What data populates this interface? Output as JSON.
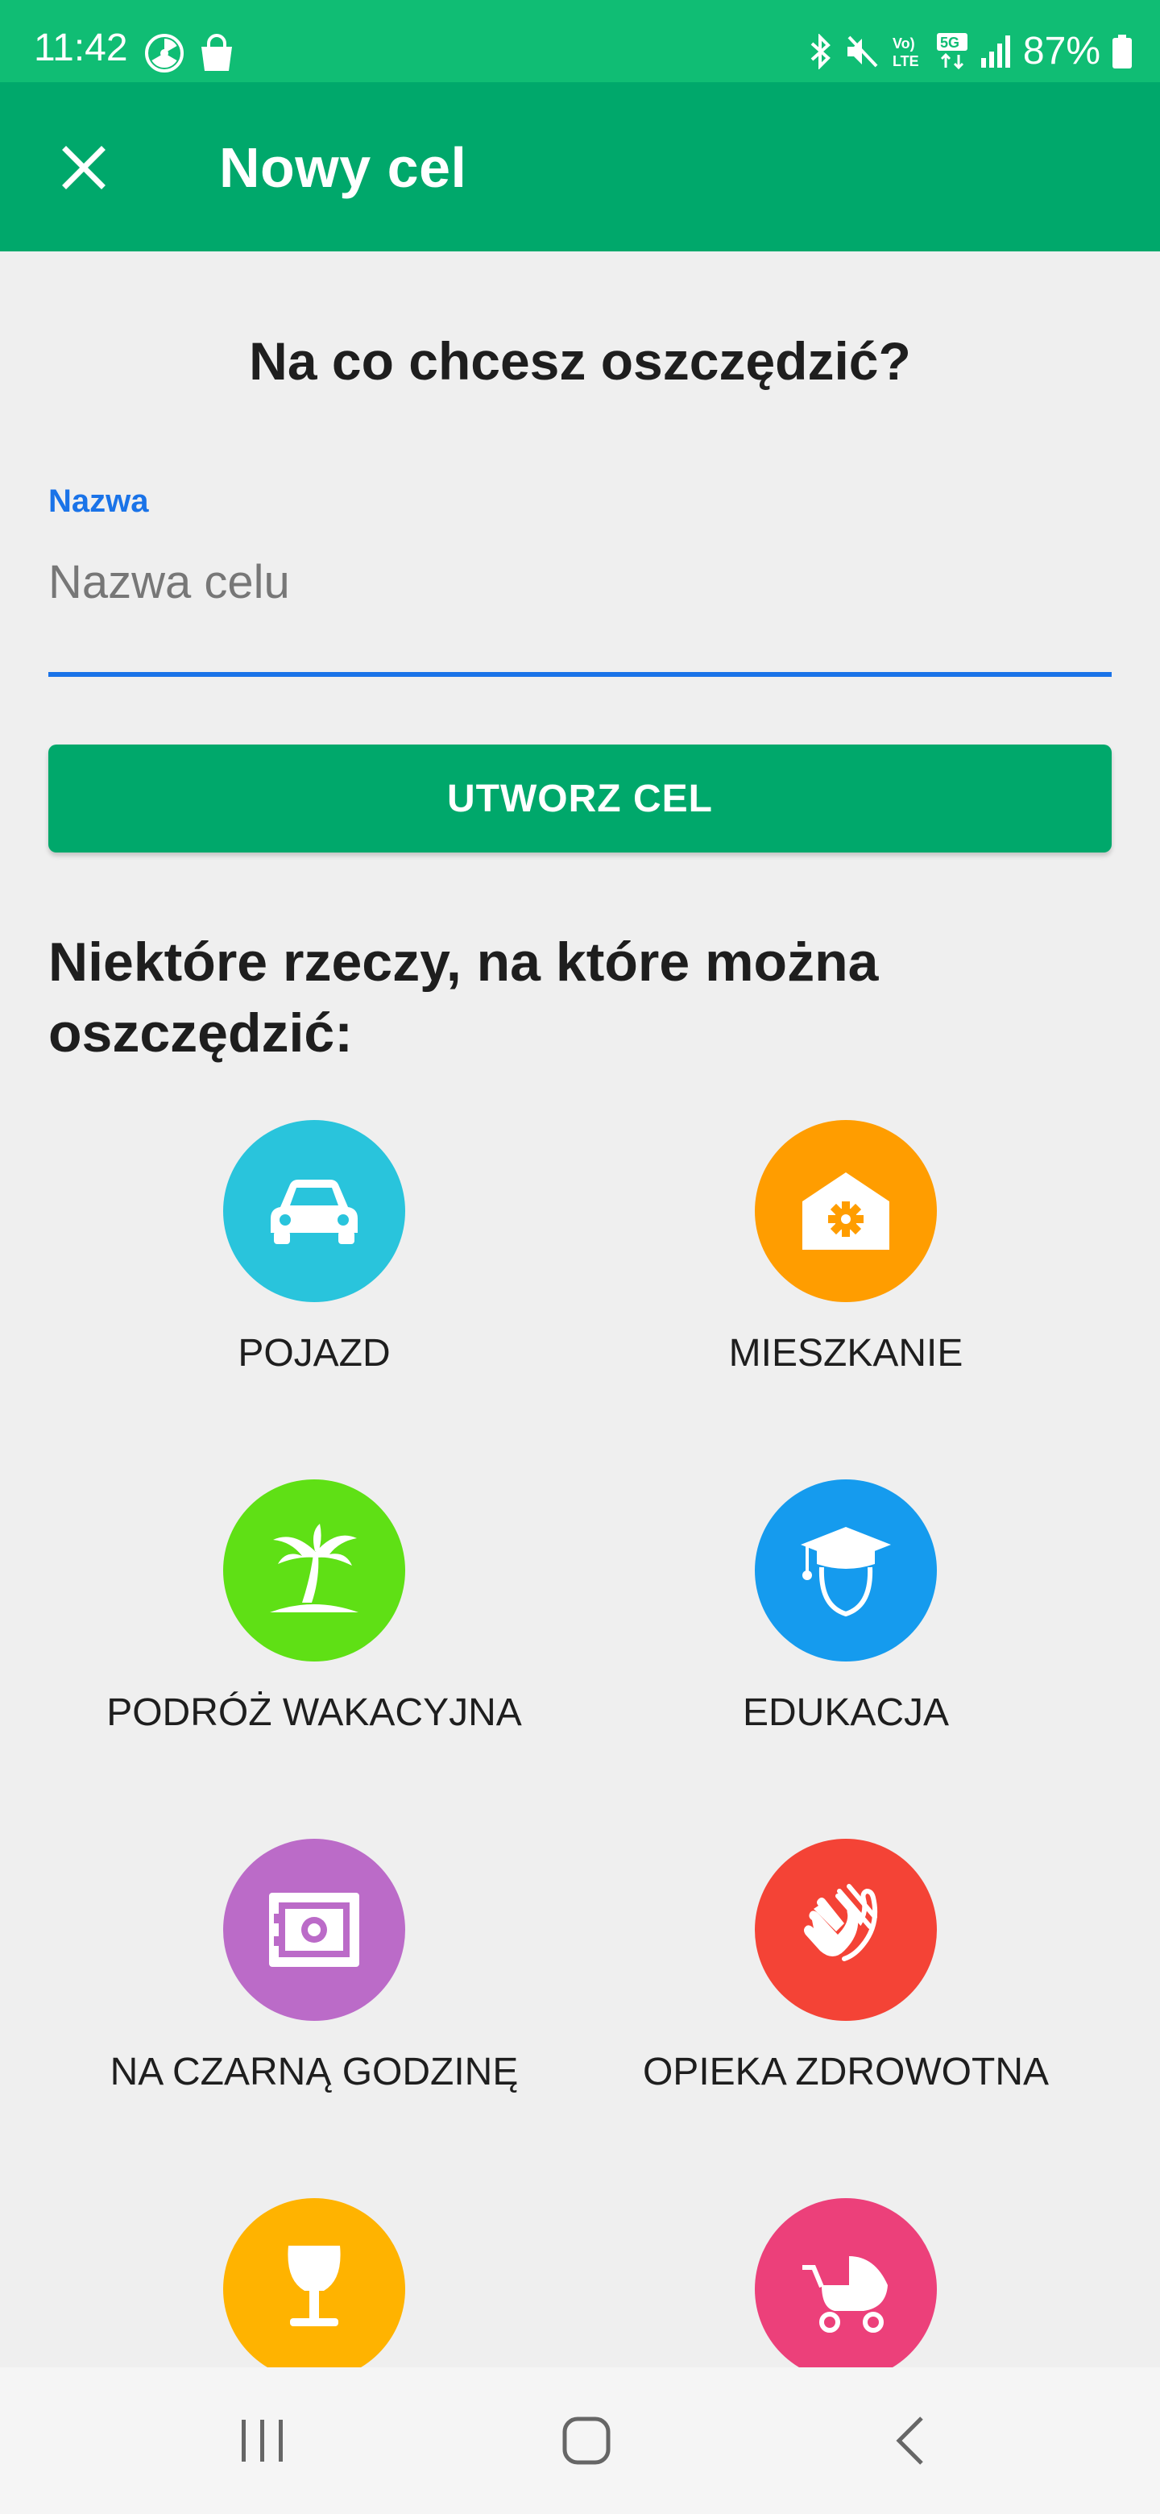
{
  "status_bar": {
    "time": "11:42",
    "battery": "87%"
  },
  "app_bar": {
    "title": "Nowy cel",
    "close_icon": "close-icon"
  },
  "form": {
    "question": "Na co chcesz oszczędzić?",
    "name_label": "Nazwa",
    "name_placeholder": "Nazwa celu",
    "name_value": "",
    "create_button": "UTWORZ CEL"
  },
  "suggestions": {
    "heading": "Niektóre rzeczy, na które można oszczędzić:",
    "items": [
      {
        "label": "POJAZD",
        "icon": "car-icon",
        "color": "#29c4dc"
      },
      {
        "label": "MIESZKANIE",
        "icon": "house-gear-icon",
        "color": "#ff9d00"
      },
      {
        "label": "PODRÓŻ WAKACYJNA",
        "icon": "palm-tree-icon",
        "color": "#5fe015"
      },
      {
        "label": "EDUKACJA",
        "icon": "graduate-icon",
        "color": "#159bee"
      },
      {
        "label": "NA CZARNĄ GODZINĘ",
        "icon": "safe-icon",
        "color": "#bb6bc8"
      },
      {
        "label": "OPIEKA ZDROWOTNA",
        "icon": "clapping-hands-icon",
        "color": "#f44336"
      },
      {
        "label": "",
        "icon": "wine-glass-icon",
        "color": "#ffb300"
      },
      {
        "label": "",
        "icon": "baby-stroller-icon",
        "color": "#ec407a"
      }
    ]
  },
  "colors": {
    "status_bar": "#10bd74",
    "app_bar": "#00a86b",
    "accent": "#1a73e8",
    "background": "#efefef"
  },
  "nav": {
    "recents_icon": "recents-icon",
    "home_icon": "home-icon",
    "back_icon": "back-icon"
  }
}
